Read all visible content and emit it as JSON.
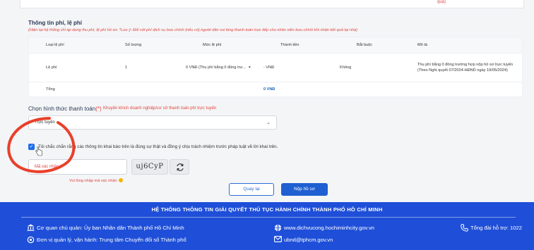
{
  "top_note": "quả)",
  "fees": {
    "title": "Thông tin phí, lệ phí",
    "note": "(Hiện tại hệ thống chỉ áp dụng thu phí, lệ phí hồ sơ. *Lưu ý: Đối với phí dịch vụ bưu chính (nếu có) người dân vui lòng thanh toán trực tiếp cho nhân viên bưu chính khi nhận kết quả tại nhà)",
    "columns": [
      "Loại lệ phí",
      "Số lượng",
      "Mức lệ phí",
      "Thành tiền",
      "Bắt buộc",
      "Mô tả"
    ],
    "row": {
      "type": "Lệ phí",
      "quantity": "1",
      "fee_level": "0 VNĐ (Thu phí bằng 0 đồng trư...",
      "amount": "- VNĐ",
      "required": "Không",
      "description": "Thu phí bằng 0 đồng trường hợp nộp hồ sơ trực tuyến (Theo Nghị quyết 07/2024-HĐND ngày 19/05/2024)"
    },
    "total_label": "Tổng",
    "total_value": "0 VNĐ"
  },
  "payment": {
    "label": "Chọn hình thức thanh toán",
    "required_mark": "(*)",
    "hint": "Khuyến khích doanh nghiệp/cơ sở thanh toán phí trực tuyến",
    "selected": "Trực tuyến"
  },
  "agreement": {
    "checked": true,
    "text": "Tôi chắc chắn rằng các thông tin khai báo trên là đúng sự thật và đồng ý chịu trách nhiệm trước pháp luật về lời khai trên."
  },
  "captcha": {
    "placeholder": "Mã xác nhận *",
    "image_text": "uj6CyP",
    "error": "Vui lòng nhập mã xác nhận"
  },
  "buttons": {
    "back": "Quay lại",
    "submit": "Nộp hồ sơ"
  },
  "footer": {
    "title": "HỆ THỐNG THÔNG TIN GIẢI QUYẾT THỦ TỤC HÀNH CHÍNH THÀNH PHỐ HỒ CHÍ MINH",
    "agency": "Cơ quan chủ quản: Ủy ban Nhân dân Thành phố Hồ Chí Minh",
    "operator": "Đơn vị quản lý, vận hành: Trung tâm Chuyển đổi số Thành phố",
    "website": "www.dichvucong.hochiminhcity.gov.vn",
    "email": "ubnd@tphcm.gov.vn",
    "hotline": "Tổng đài hỗ trợ: 1022"
  },
  "colors": {
    "primary": "#1f5fd1",
    "footer": "#1f4fd8",
    "error": "#e0443e",
    "annotation": "#e8402a"
  }
}
